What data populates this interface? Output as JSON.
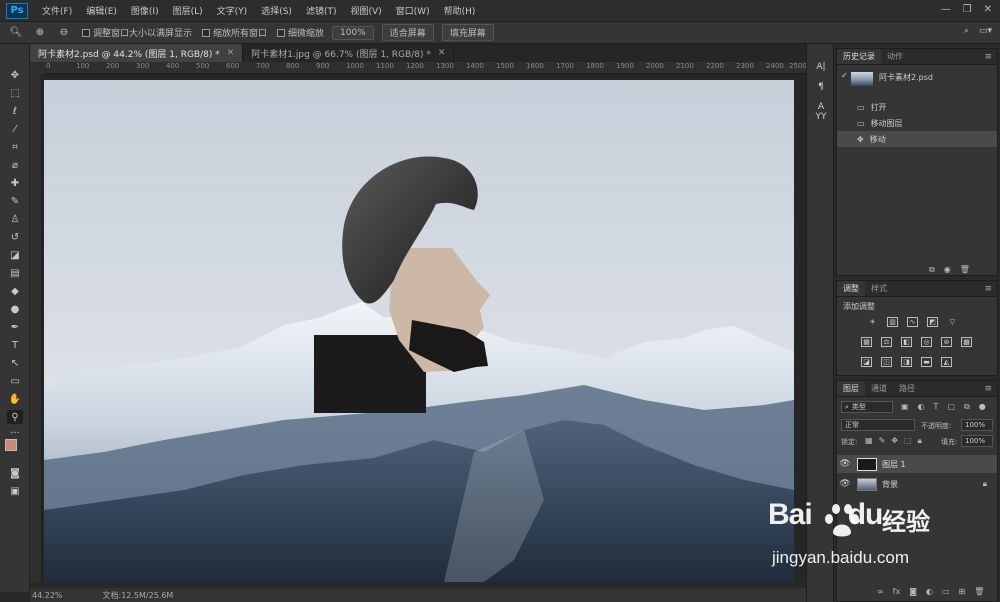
{
  "app": {
    "logo": "Ps"
  },
  "menu": [
    "文件(F)",
    "编辑(E)",
    "图像(I)",
    "图层(L)",
    "文字(Y)",
    "选择(S)",
    "滤镜(T)",
    "视图(V)",
    "窗口(W)",
    "帮助(H)"
  ],
  "window_controls": [
    "—",
    "❐",
    "✕"
  ],
  "options_bar": {
    "resize_windows_label": "调整窗口大小以满屏显示",
    "zoom_all_label": "缩放所有窗口",
    "scrubby_label": "细微缩放",
    "zoom_value": "100%",
    "fit_screen_label": "适合屏幕",
    "fill_screen_label": "填充屏幕"
  },
  "tabs": [
    {
      "label": "阿卡素材2.psd @ 44.2% (图层 1, RGB/8) *",
      "active": true
    },
    {
      "label": "阿卡素材1.jpg @ 66.7% (图层 1, RGB/8) *",
      "active": false
    }
  ],
  "ruler_ticks": [
    "0",
    "100",
    "200",
    "300",
    "400",
    "500",
    "600",
    "700",
    "800",
    "900",
    "1000",
    "1100",
    "1200",
    "1300",
    "1400",
    "1500",
    "1600",
    "1700",
    "1800",
    "1900",
    "2000",
    "2100",
    "2200",
    "2300",
    "2400",
    "2500"
  ],
  "status": {
    "zoom": "44.22%",
    "doc": "文档:12.5M/25.6M"
  },
  "history_panel": {
    "tabs": [
      "历史记录",
      "动作"
    ],
    "snapshot": "阿卡素材2.psd",
    "items": [
      "打开",
      "移动图层",
      "移动"
    ]
  },
  "adjustments_panel": {
    "tabs": [
      "调整",
      "样式"
    ],
    "title": "添加调整"
  },
  "layers_panel": {
    "tabs": [
      "图层",
      "通道",
      "路径"
    ],
    "filter_kind": "类型",
    "blend_mode": "正常",
    "opacity_label": "不透明度:",
    "opacity_value": "100%",
    "lock_label": "锁定:",
    "fill_label": "填充:",
    "fill_value": "100%",
    "layers": [
      {
        "name": "图层 1",
        "active": true
      },
      {
        "name": "背景",
        "active": false
      }
    ]
  },
  "watermark": {
    "brand": "Bai",
    "brand2": "du",
    "cn": "经验",
    "url": "jingyan.baidu.com"
  }
}
